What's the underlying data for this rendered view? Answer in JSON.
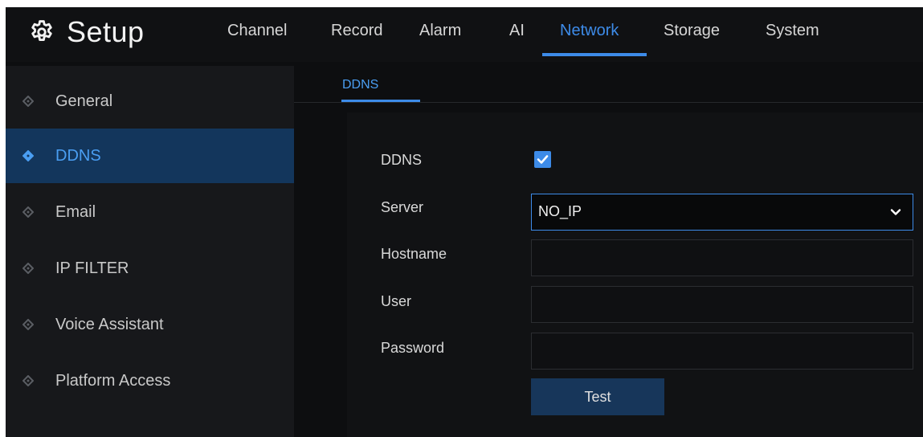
{
  "header": {
    "title": "Setup",
    "tabs": [
      {
        "label": "Channel"
      },
      {
        "label": "Record"
      },
      {
        "label": "Alarm"
      },
      {
        "label": "AI"
      },
      {
        "label": "Network"
      },
      {
        "label": "Storage"
      },
      {
        "label": "System"
      }
    ],
    "active_tab": "Network"
  },
  "sidebar": {
    "items": [
      {
        "label": "General"
      },
      {
        "label": "DDNS"
      },
      {
        "label": "Email"
      },
      {
        "label": "IP FILTER"
      },
      {
        "label": "Voice Assistant"
      },
      {
        "label": "Platform Access"
      }
    ],
    "active_item": "DDNS"
  },
  "subtab": {
    "label": "DDNS"
  },
  "form": {
    "ddns_label": "DDNS",
    "ddns_enabled": true,
    "server_label": "Server",
    "server_value": "NO_IP",
    "hostname_label": "Hostname",
    "hostname_value": "",
    "user_label": "User",
    "user_value": "",
    "password_label": "Password",
    "password_value": "",
    "test_label": "Test"
  },
  "colors": {
    "accent": "#3d8be8",
    "background": "#0d0e10",
    "sidebar": "#17181b",
    "sidebar_active": "#13365c",
    "button": "#17365a"
  }
}
